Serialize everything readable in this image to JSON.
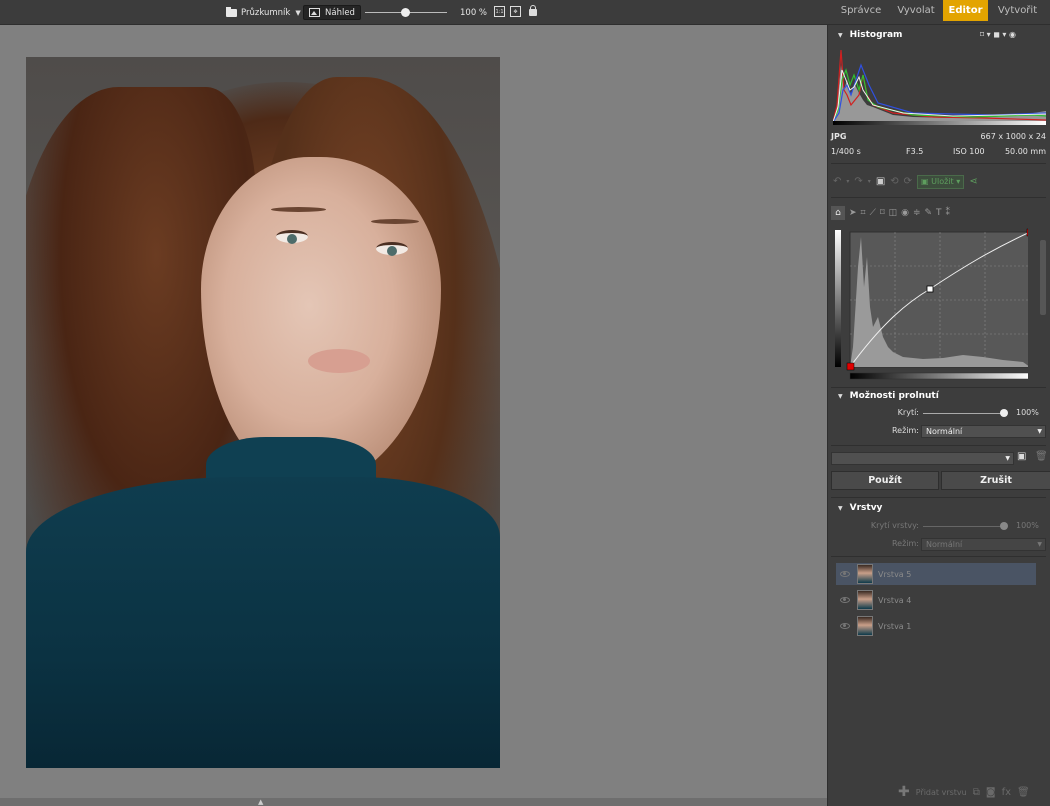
{
  "topbar": {
    "browser_label": "Průzkumník",
    "preview_label": "Náhled",
    "zoom_value": "100 %",
    "zoom_level": 0.45,
    "fit_label": "1:1"
  },
  "modes": [
    {
      "label": "Správce",
      "active": false
    },
    {
      "label": "Vyvolat",
      "active": false
    },
    {
      "label": "Editor",
      "active": true
    },
    {
      "label": "Vytvořit",
      "active": false
    }
  ],
  "panel": {
    "histogram": {
      "title": "Histogram"
    },
    "file_info": {
      "format": "JPG",
      "dimensions": "667 x 1000 x 24",
      "shutter": "1/400 s",
      "aperture": "F3.5",
      "iso": "ISO 100",
      "focal": "50.00 mm"
    },
    "toolbar": {
      "save_label": "Uložit"
    },
    "blend": {
      "title": "Možnosti prolnutí",
      "opacity_label": "Krytí:",
      "opacity_value": "100%",
      "opacity_level": 1.0,
      "mode_label": "Režim:",
      "mode_value": "Normální"
    },
    "preset": {
      "value": ""
    },
    "actions": {
      "apply_label": "Použít",
      "cancel_label": "Zrušit"
    },
    "layers": {
      "title": "Vrstvy",
      "opacity_label": "Krytí vrstvy:",
      "opacity_value": "100%",
      "mode_label": "Režim:",
      "mode_value": "Normální",
      "items": [
        {
          "name": "Vrstva 5",
          "selected": true
        },
        {
          "name": "Vrstva 4",
          "selected": false
        },
        {
          "name": "Vrstva 1",
          "selected": false
        }
      ],
      "add_layer_label": "Přidat vrstvu"
    }
  },
  "colors": {
    "accent": "#e3a400",
    "panel_bg": "#3d3d3d",
    "canvas_bg": "#808080",
    "curve_point": "#e00000"
  }
}
